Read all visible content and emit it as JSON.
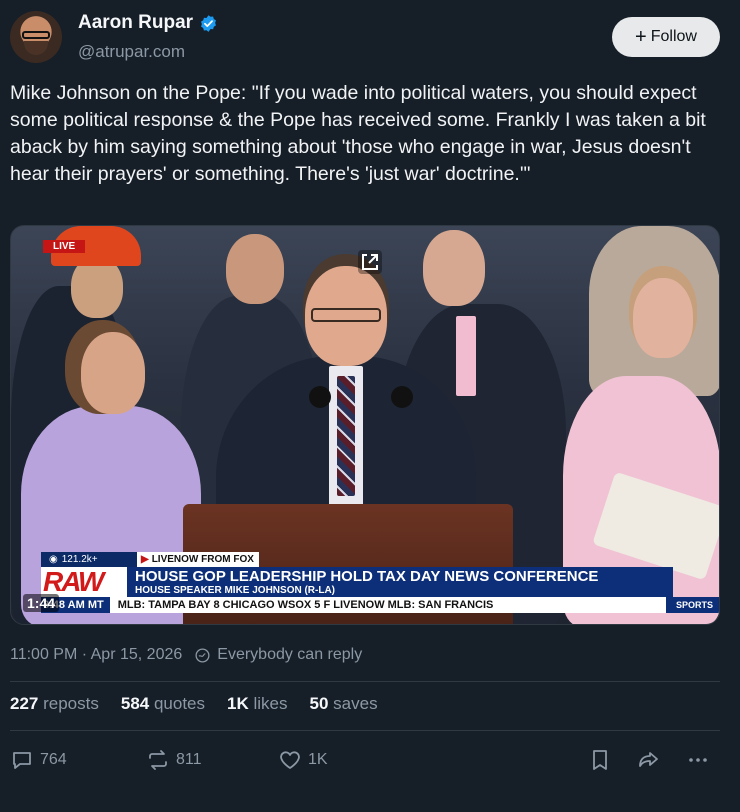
{
  "author": {
    "display_name": "Aaron Rupar",
    "handle": "@atrupar.com",
    "verified": true
  },
  "follow_button": {
    "label": "Follow"
  },
  "post": {
    "text": "Mike Johnson on the Pope: \"If you wade into political waters, you should expect some political response & the Pope has received some. Frankly I was taken a bit aback by him saying something about 'those who engage in war, Jesus doesn't hear their prayers' or something. There's 'just war' doctrine.'\""
  },
  "video": {
    "live_badge": "LIVE",
    "views": "121.2k+",
    "source": "LIVENOW FROM FOX",
    "raw_logo": "RAW",
    "headline": "HOUSE GOP LEADERSHIP HOLD TAX DAY NEWS CONFERENCE",
    "subheadline": "HOUSE SPEAKER MIKE JOHNSON (R-LA)",
    "clock": "8:48 AM MT",
    "scroll_text": "MLB:  TAMPA BAY  8   CHICAGO WSOX  5  F   LIVENOW   MLB:  SAN FRANCIS",
    "sports_tag": "SPORTS",
    "duration": "1:44"
  },
  "meta": {
    "timestamp": "11:00 PM · Apr 15, 2026",
    "reply_setting": "Everybody can reply"
  },
  "stats": {
    "reposts_count": "227",
    "reposts_label": "reposts",
    "quotes_count": "584",
    "quotes_label": "quotes",
    "likes_count": "1K",
    "likes_label": "likes",
    "saves_count": "50",
    "saves_label": "saves"
  },
  "actions": {
    "replies": "764",
    "reposts": "811",
    "likes": "1K"
  },
  "colors": {
    "background": "#161e27",
    "verified": "#1d9bf0",
    "muted": "#8b98a5"
  }
}
